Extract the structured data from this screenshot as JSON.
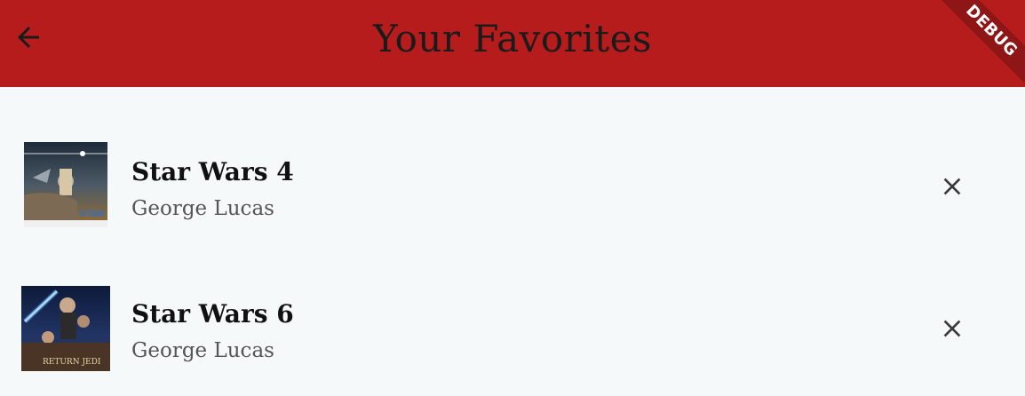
{
  "appbar": {
    "title": "Your Favorites",
    "back_icon": "arrow-back-icon",
    "background_color": "#b71c1c"
  },
  "debug_banner": {
    "label": "DEBUG"
  },
  "favorites": [
    {
      "title": "Star Wars 4",
      "director": "George Lucas",
      "remove_icon": "close-icon"
    },
    {
      "title": "Star Wars 6",
      "director": "George Lucas",
      "remove_icon": "close-icon"
    }
  ]
}
